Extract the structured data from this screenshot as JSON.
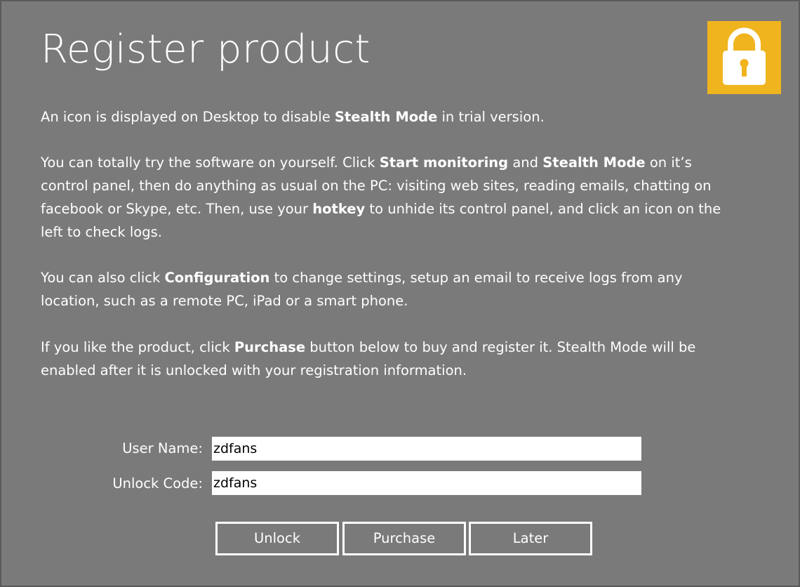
{
  "window": {
    "title": "Register product"
  },
  "icons": {
    "lock": "padlock-icon",
    "lock_color": "#f0b41e"
  },
  "content": {
    "p1": {
      "t1": "An icon is displayed on Desktop to disable ",
      "b1": "Stealth Mode",
      "t2": " in trial version."
    },
    "p2": {
      "t1": "You can totally try the software on yourself. Click ",
      "b1": "Start monitoring",
      "t2": " and ",
      "b2": "Stealth Mode",
      "t3": " on it’s control panel, then do anything as usual on the PC: visiting web sites, reading emails, chatting on facebook or Skype, etc. Then, use your ",
      "b3": "hotkey",
      "t4": " to unhide its control panel, and click an icon on the left to check logs."
    },
    "p3": {
      "t1": "You can also click ",
      "b1": "Configuration",
      "t2": " to change settings, setup an email to receive logs from any location, such as a remote PC, iPad or a smart phone."
    },
    "p4": {
      "t1": "If you like the product, click ",
      "b1": "Purchase",
      "t2": " button below to buy and register it. Stealth Mode will be enabled after it is unlocked with your registration information."
    }
  },
  "form": {
    "user_name_label": "User Name:",
    "user_name_value": "zdfans",
    "unlock_code_label": "Unlock Code:",
    "unlock_code_value": "zdfans"
  },
  "buttons": {
    "unlock": "Unlock",
    "purchase": "Purchase",
    "later": "Later"
  }
}
